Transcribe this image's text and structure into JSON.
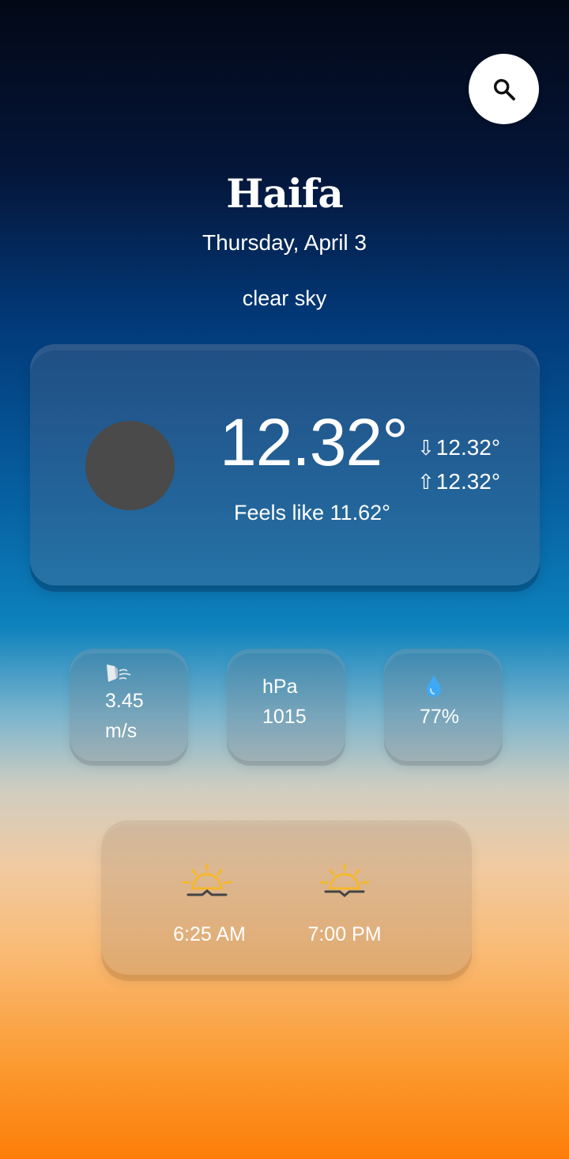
{
  "header": {
    "search_icon": "search-icon"
  },
  "location": {
    "city": "Haifa",
    "date": "Thursday, April 3",
    "condition": "clear sky"
  },
  "current": {
    "temperature": "12.32°",
    "temp_min": "12.32°",
    "temp_max": "12.32°",
    "feels_like": "Feels like 11.62°",
    "icon": "weather-icon-placeholder"
  },
  "details": {
    "wind": {
      "value": "3.45",
      "unit": "m/s",
      "icon": "wind-icon"
    },
    "pressure": {
      "unit": "hPa",
      "value": "1015"
    },
    "humidity": {
      "value": "77%",
      "icon": "droplet-icon"
    }
  },
  "sun": {
    "sunrise": "6:25 AM",
    "sunset": "7:00 PM",
    "sunrise_icon": "sunrise-icon",
    "sunset_icon": "sunset-icon"
  },
  "colors": {
    "sun_yellow": "#f5b82b",
    "icon_dark": "#444444"
  }
}
